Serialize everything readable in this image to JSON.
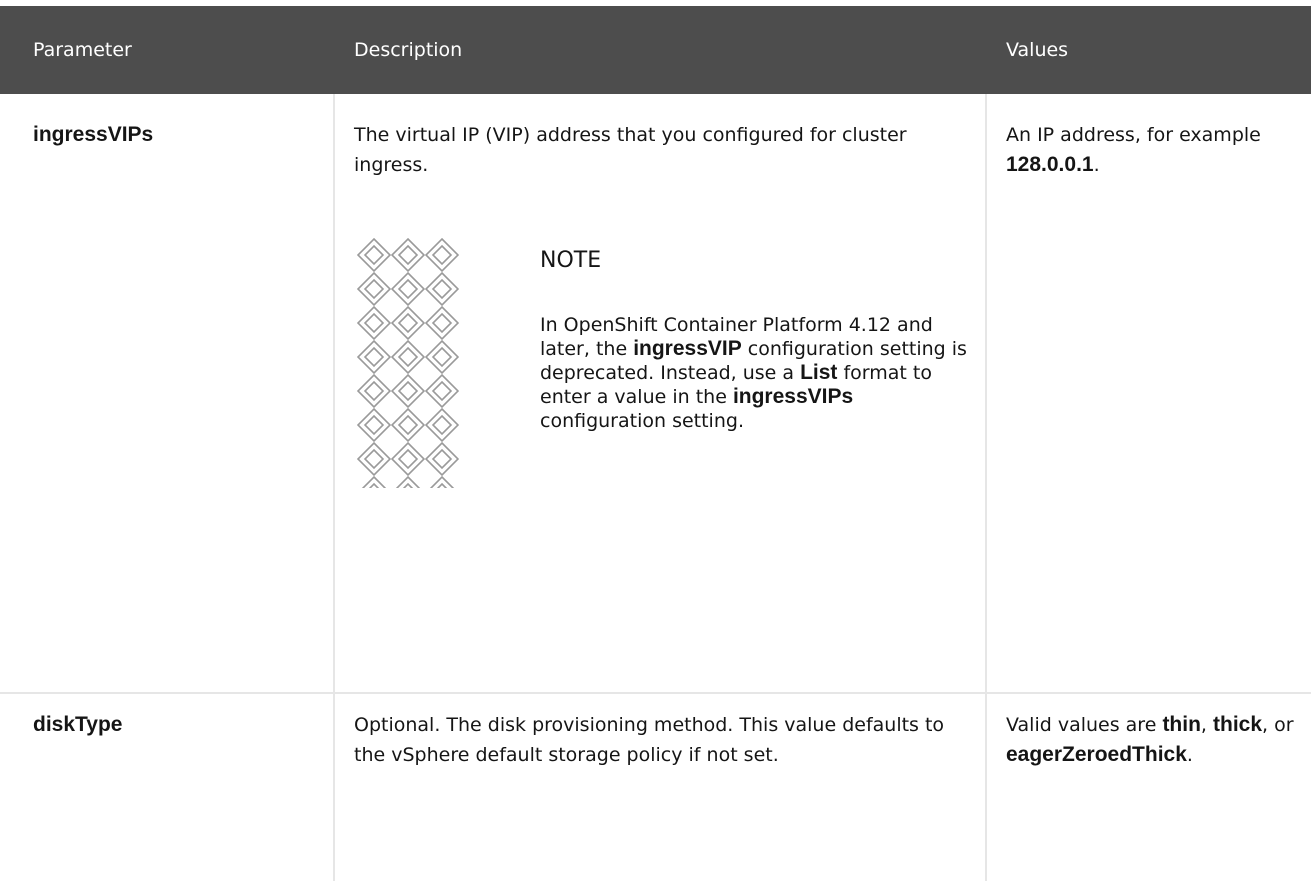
{
  "table": {
    "headers": {
      "parameter": "Parameter",
      "description": "Description",
      "values": "Values"
    },
    "rows": [
      {
        "parameter": "ingressVIPs",
        "description": "The virtual IP (VIP) address that you configured for cluster ingress.",
        "values": {
          "prefix": "An IP address, for example ",
          "code": "128.0.0.1",
          "suffix": "."
        },
        "note": {
          "icon": "note-pattern-icon",
          "title": "NOTE",
          "text1": "In OpenShift Container Platform 4.12 and later, the ",
          "code1": "ingressVIP",
          "text2": " configuration setting is deprecated. Instead, use a ",
          "code2": "List",
          "text3": " format to enter a value in the ",
          "code3": "ingressVIPs",
          "text4": " configuration setting."
        }
      },
      {
        "parameter": "diskType",
        "description": "Optional. The disk provisioning method. This value defaults to the vSphere default storage policy if not set.",
        "values": {
          "prefix": "Valid values are ",
          "code1": "thin",
          "sep1": ", ",
          "code2": "thick",
          "sep2": ", or ",
          "code3": "eagerZeroedThick",
          "suffix": "."
        }
      }
    ]
  }
}
